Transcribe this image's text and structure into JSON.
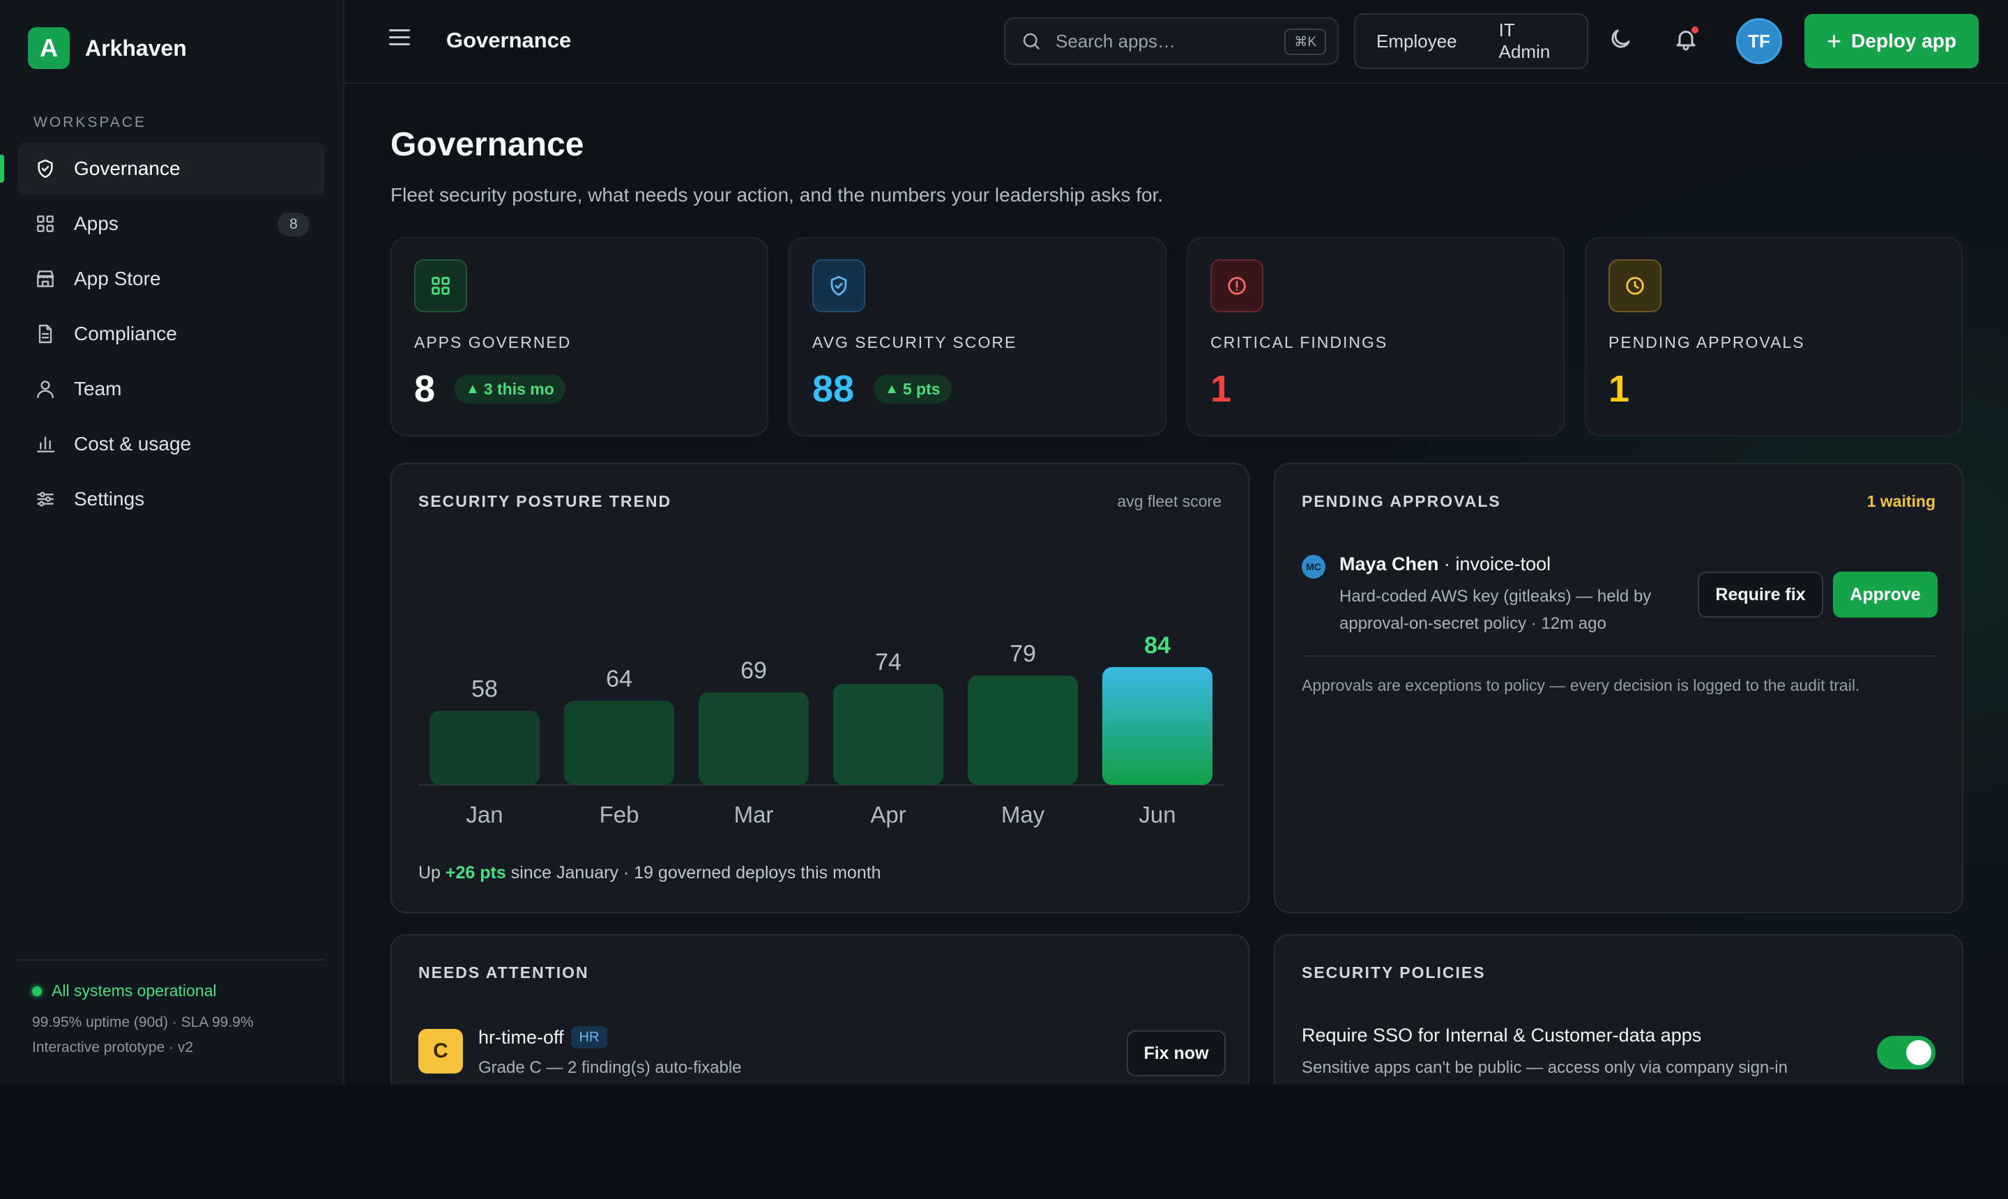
{
  "brand": {
    "name": "Arkhaven",
    "logo_letter": "A"
  },
  "sidebar": {
    "section_label": "WORKSPACE",
    "items": [
      {
        "label": "Governance",
        "icon": "shield-icon",
        "active": true
      },
      {
        "label": "Apps",
        "icon": "grid-icon",
        "badge": "8"
      },
      {
        "label": "App Store",
        "icon": "store-icon"
      },
      {
        "label": "Compliance",
        "icon": "document-icon"
      },
      {
        "label": "Team",
        "icon": "user-icon"
      },
      {
        "label": "Cost & usage",
        "icon": "bar-chart-icon"
      },
      {
        "label": "Settings",
        "icon": "sliders-icon"
      }
    ],
    "footer": {
      "status": "All systems operational",
      "uptime": "99.95% uptime (90d) · SLA 99.9%",
      "version": "Interactive prototype · v2"
    }
  },
  "topbar": {
    "title": "Governance",
    "search_placeholder": "Search apps…",
    "search_shortcut": "⌘K",
    "roles": [
      "Employee",
      "IT Admin"
    ],
    "avatar_initials": "TF",
    "deploy_label": "Deploy app"
  },
  "page": {
    "title": "Governance",
    "subtitle": "Fleet security posture, what needs your action, and the numbers your leadership asks for."
  },
  "stats": [
    {
      "label": "APPS GOVERNED",
      "value": "8",
      "delta": "3 this mo",
      "color": "#ffffff",
      "icon": "grid-icon"
    },
    {
      "label": "AVG SECURITY SCORE",
      "value": "88",
      "delta": "5 pts",
      "color": "#38bdf8",
      "icon": "shield-icon"
    },
    {
      "label": "CRITICAL FINDINGS",
      "value": "1",
      "color": "#ef4444",
      "icon": "alert-circle-icon"
    },
    {
      "label": "PENDING APPROVALS",
      "value": "1",
      "color": "#facc15",
      "icon": "clock-icon"
    }
  ],
  "trend": {
    "title": "SECURITY POSTURE TREND",
    "aside": "avg fleet score",
    "footer_prefix": "Up ",
    "footer_pts": "+26 pts",
    "footer_suffix": " since January · 19 governed deploys this month"
  },
  "chart_data": {
    "type": "bar",
    "categories": [
      "Jan",
      "Feb",
      "Mar",
      "Apr",
      "May",
      "Jun"
    ],
    "values": [
      58,
      64,
      69,
      74,
      79,
      84
    ],
    "title": "SECURITY POSTURE TREND",
    "ylabel": "avg fleet score",
    "highlight": "Jun",
    "colors": {
      "bar": "#12502f",
      "highlight_top": "#3ab8e6",
      "highlight_bottom": "#12a047",
      "highlight_label": "#4ade80"
    }
  },
  "approvals": {
    "title": "PENDING APPROVALS",
    "aside": "1 waiting",
    "item": {
      "avatar": "MC",
      "name": "Maya Chen",
      "app": " · invoice-tool",
      "desc": "Hard-coded AWS key (gitleaks) — held by approval-on-secret policy · 12m ago",
      "require_fix_label": "Require fix",
      "approve_label": "Approve"
    },
    "note": "Approvals are exceptions to policy — every decision is logged to the audit trail."
  },
  "attention": {
    "title": "NEEDS ATTENTION",
    "item": {
      "grade": "C",
      "name": "hr-time-off",
      "tag": "HR",
      "desc": "Grade C — 2 finding(s) auto-fixable",
      "action": "Fix now"
    }
  },
  "policies": {
    "title": "SECURITY POLICIES",
    "item": {
      "name": "Require SSO for Internal & Customer-data apps",
      "desc": "Sensitive apps can't be public — access only via company sign-in",
      "enabled": true
    }
  }
}
